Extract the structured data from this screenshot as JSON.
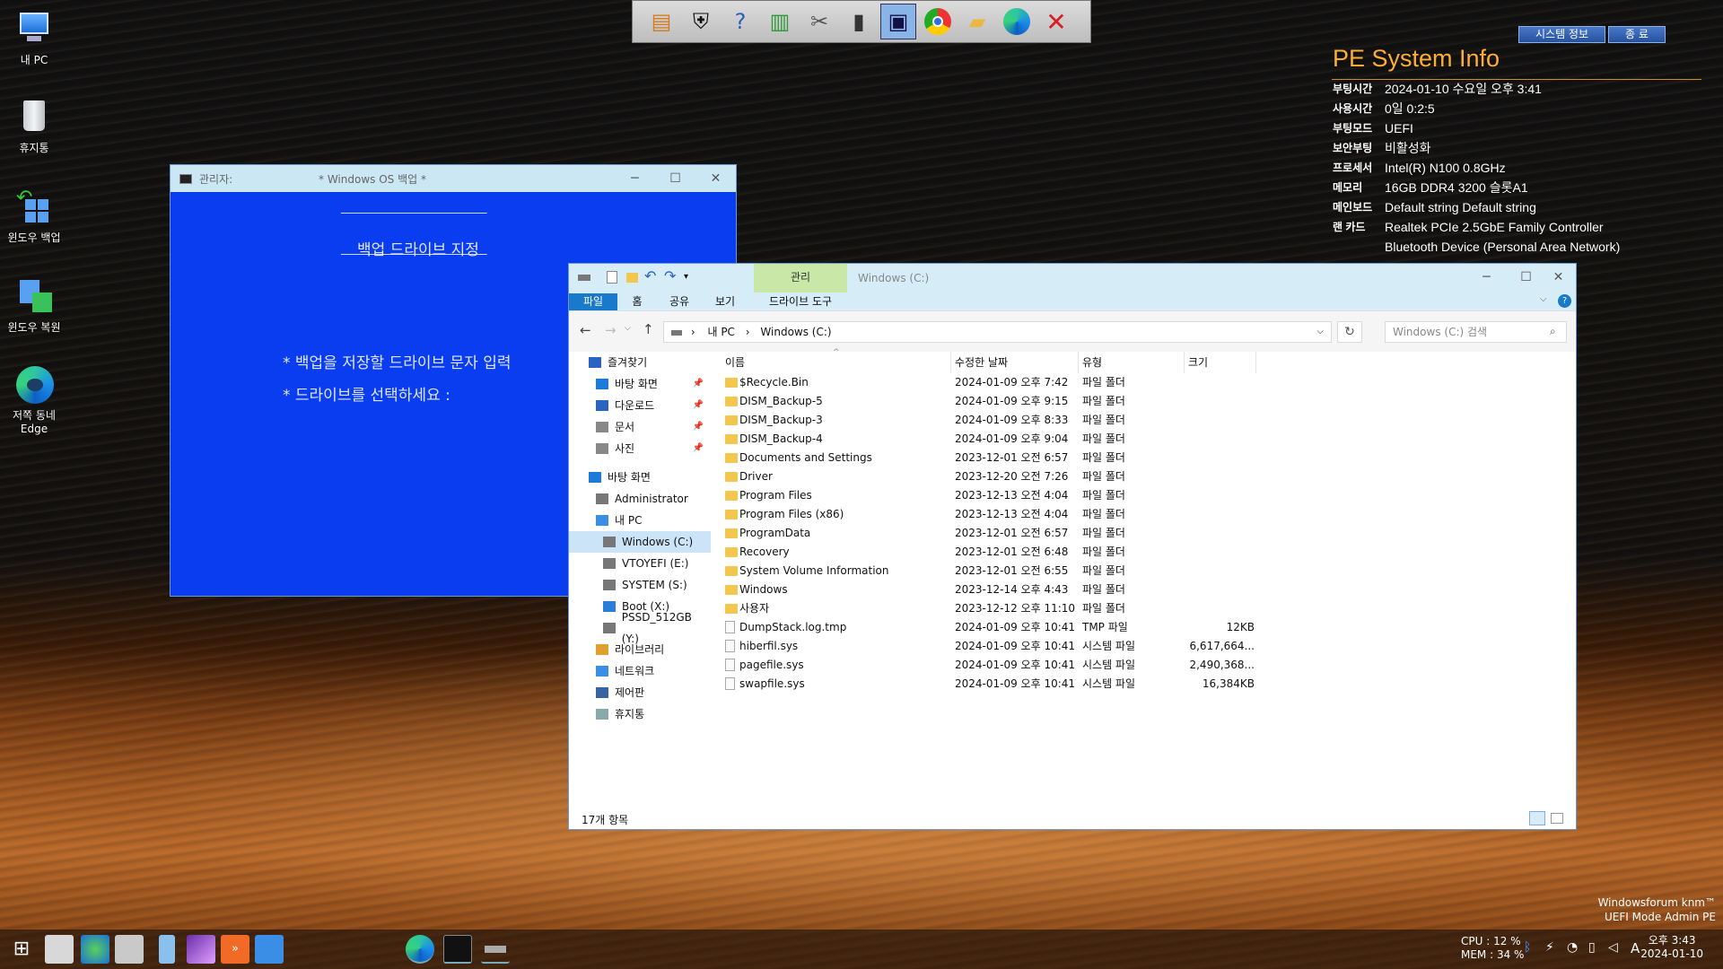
{
  "desktop": {
    "icons": [
      {
        "label": "내 PC",
        "icon": "pc-icon"
      },
      {
        "label": "휴지통",
        "icon": "recycle-bin-icon"
      },
      {
        "label": "윈도우 백업",
        "icon": "backup-icon"
      },
      {
        "label": "윈도우 복원",
        "icon": "restore-icon"
      },
      {
        "label": "저쪽 동네 Edge",
        "icon": "edge-icon"
      }
    ]
  },
  "quickbar": {
    "icons": [
      "explorer-tool-icon",
      "shield-icon",
      "help-icon",
      "chart-icon",
      "tools-icon",
      "sd-card-icon",
      "remote-display-icon",
      "chrome-icon",
      "folder-add-icon",
      "edge-icon",
      "close-icon"
    ]
  },
  "pe_info": {
    "buttons": [
      "시스템 정보",
      "종 료"
    ],
    "title": "PE System Info",
    "rows": [
      {
        "key": "부팅시간",
        "value": "2024-01-10 수요일 오후 3:41"
      },
      {
        "key": "사용시간",
        "value": "0일 0:2:5"
      },
      {
        "key": "부팅모드",
        "value": "UEFI"
      },
      {
        "key": "보안부팅",
        "value": "비활성화"
      },
      {
        "key": "프로세서",
        "value": "Intel(R) N100 0.8GHz"
      },
      {
        "key": "메모리",
        "value": "16GB DDR4 3200 슬롯A1"
      },
      {
        "key": "메인보드",
        "value": "Default string Default string"
      },
      {
        "key": "랜 카드",
        "value": "Realtek PCIe 2.5GbE Family Controller"
      },
      {
        "key": "",
        "value": "Bluetooth Device (Personal Area Network)"
      }
    ]
  },
  "cmd_window": {
    "title": "관리자:",
    "center_title": "* Windows OS 백업 *",
    "heading_line": "_________________________",
    "heading": "백업 드라이브 지정",
    "line1": "* 백업을 저장할 드라이브 문자 입력",
    "line2": "* 드라이브를 선택하세요 :",
    "controls": [
      "─",
      "☐",
      "✕"
    ]
  },
  "explorer": {
    "context_tab": "관리",
    "title": "Windows (C:)",
    "ribbon_tabs": [
      "파일",
      "홈",
      "공유",
      "보기",
      "드라이브 도구"
    ],
    "breadcrumb": [
      "내 PC",
      "Windows (C:)"
    ],
    "search_placeholder": "Windows (C:) 검색",
    "nav": [
      {
        "label": "즐겨찾기",
        "indent": 1,
        "pin": false
      },
      {
        "label": "바탕 화면",
        "indent": 2,
        "pin": true
      },
      {
        "label": "다운로드",
        "indent": 2,
        "pin": true
      },
      {
        "label": "문서",
        "indent": 2,
        "pin": true
      },
      {
        "label": "사진",
        "indent": 2,
        "pin": true
      },
      {
        "label": "바탕 화면",
        "indent": 1,
        "pin": false
      },
      {
        "label": "Administrator",
        "indent": 2,
        "pin": false
      },
      {
        "label": "내 PC",
        "indent": 2,
        "pin": false
      },
      {
        "label": "Windows (C:)",
        "indent": 3,
        "pin": false,
        "selected": true
      },
      {
        "label": "VTOYEFI (E:)",
        "indent": 3,
        "pin": false
      },
      {
        "label": "SYSTEM (S:)",
        "indent": 3,
        "pin": false
      },
      {
        "label": "Boot (X:)",
        "indent": 3,
        "pin": false
      },
      {
        "label": "PSSD_512GB (Y:)",
        "indent": 3,
        "pin": false
      },
      {
        "label": "라이브러리",
        "indent": 2,
        "pin": false
      },
      {
        "label": "네트워크",
        "indent": 2,
        "pin": false
      },
      {
        "label": "제어판",
        "indent": 2,
        "pin": false
      },
      {
        "label": "휴지통",
        "indent": 2,
        "pin": false
      }
    ],
    "columns": [
      "이름",
      "수정한 날짜",
      "유형",
      "크기"
    ],
    "files": [
      {
        "name": "$Recycle.Bin",
        "date": "2024-01-09 오후 7:42",
        "type": "파일 폴더",
        "size": "",
        "folder": true
      },
      {
        "name": "DISM_Backup-5",
        "date": "2024-01-09 오후 9:15",
        "type": "파일 폴더",
        "size": "",
        "folder": true
      },
      {
        "name": "DISM_Backup-3",
        "date": "2024-01-09 오후 8:33",
        "type": "파일 폴더",
        "size": "",
        "folder": true
      },
      {
        "name": "DISM_Backup-4",
        "date": "2024-01-09 오후 9:04",
        "type": "파일 폴더",
        "size": "",
        "folder": true
      },
      {
        "name": "Documents and Settings",
        "date": "2023-12-01 오전 6:57",
        "type": "파일 폴더",
        "size": "",
        "folder": true
      },
      {
        "name": "Driver",
        "date": "2023-12-20 오전 7:26",
        "type": "파일 폴더",
        "size": "",
        "folder": true
      },
      {
        "name": "Program Files",
        "date": "2023-12-13 오전 4:04",
        "type": "파일 폴더",
        "size": "",
        "folder": true
      },
      {
        "name": "Program Files (x86)",
        "date": "2023-12-13 오전 4:04",
        "type": "파일 폴더",
        "size": "",
        "folder": true
      },
      {
        "name": "ProgramData",
        "date": "2023-12-01 오전 6:57",
        "type": "파일 폴더",
        "size": "",
        "folder": true
      },
      {
        "name": "Recovery",
        "date": "2023-12-01 오전 6:48",
        "type": "파일 폴더",
        "size": "",
        "folder": true
      },
      {
        "name": "System Volume Information",
        "date": "2023-12-01 오전 6:55",
        "type": "파일 폴더",
        "size": "",
        "folder": true
      },
      {
        "name": "Windows",
        "date": "2023-12-14 오후 4:43",
        "type": "파일 폴더",
        "size": "",
        "folder": true
      },
      {
        "name": "사용자",
        "date": "2023-12-12 오후 11:10",
        "type": "파일 폴더",
        "size": "",
        "folder": true
      },
      {
        "name": "DumpStack.log.tmp",
        "date": "2024-01-09 오후 10:41",
        "type": "TMP 파일",
        "size": "12KB",
        "folder": false
      },
      {
        "name": "hiberfil.sys",
        "date": "2024-01-09 오후 10:41",
        "type": "시스템 파일",
        "size": "6,617,664...",
        "folder": false
      },
      {
        "name": "pagefile.sys",
        "date": "2024-01-09 오후 10:41",
        "type": "시스템 파일",
        "size": "2,490,368...",
        "folder": false
      },
      {
        "name": "swapfile.sys",
        "date": "2024-01-09 오후 10:41",
        "type": "시스템 파일",
        "size": "16,384KB",
        "folder": false
      }
    ],
    "status": "17개 항목"
  },
  "taskbar": {
    "cpu": "CPU : 12 %",
    "mem": "MEM : 34 %",
    "time": "오후 3:43",
    "date": "2024-01-10",
    "ime": "A"
  },
  "watermark": {
    "line1": "Windowsforum knm™",
    "line2": "UEFI Mode Admin PE"
  },
  "colors": {
    "accent": "#ffae35",
    "console_bg": "#0a3cf0",
    "ribbon_file": "#1979ca"
  }
}
